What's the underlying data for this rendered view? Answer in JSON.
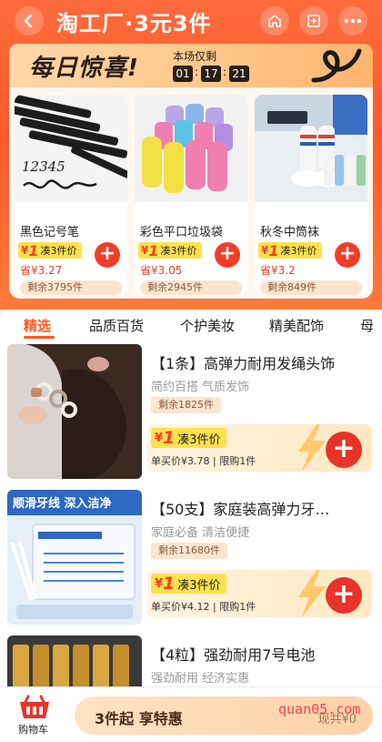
{
  "header": {
    "title": "淘工厂·3元3件",
    "back_icon": "back-arrow-icon",
    "home_icon": "home-icon",
    "fav_icon": "bookmark-icon",
    "more_icon": "more-dots-icon"
  },
  "banner": {
    "title": "每日惊喜!",
    "countdown_label": "本场仅剩",
    "countdown": [
      "01",
      "17",
      "21"
    ]
  },
  "deals": [
    {
      "name": "黑色记号笔",
      "price_yen": "¥",
      "price_num": "1",
      "price_suffix": "凑3件价",
      "save": "省¥3.27",
      "remain": "剩余3795件"
    },
    {
      "name": "彩色平口垃圾袋",
      "price_yen": "¥",
      "price_num": "1",
      "price_suffix": "凑3件价",
      "save": "省¥3.05",
      "remain": "剩余2945件"
    },
    {
      "name": "秋冬中筒袜",
      "price_yen": "¥",
      "price_num": "1",
      "price_suffix": "凑3件价",
      "save": "省¥3.2",
      "remain": "剩余849件"
    }
  ],
  "tabs": [
    "精选",
    "品质百货",
    "个护美妆",
    "精美配饰",
    "母"
  ],
  "items": [
    {
      "title": "【1条】高弹力耐用发绳头饰",
      "tags": "简约百搭 气质发饰",
      "remain": "剩余1825件",
      "price_yen": "¥",
      "price_num": "1",
      "price_suffix": "凑3件价",
      "info": "单买价¥3.78 | 限购1件"
    },
    {
      "title": "【50支】家庭装高弹力牙…",
      "tags": "家庭必备 清洁便捷",
      "remain": "剩余11680件",
      "price_yen": "¥",
      "price_num": "1",
      "price_suffix": "凑3件价",
      "info": "单买价¥4.12 | 限购1件"
    },
    {
      "title": "【4粒】强劲耐用7号电池",
      "tags": "强劲耐用 经济实惠",
      "remain": "",
      "price_yen": "",
      "price_num": "",
      "price_suffix": "",
      "info": ""
    }
  ],
  "bottom": {
    "cart_label": "购物车",
    "cta_text": "3件起 享特惠",
    "cash": "现共¥0"
  },
  "watermark": "quan05.com",
  "colors": {
    "accent": "#ff5a2a",
    "plus": "#f23c2a",
    "price_tag": "#ffe14d"
  }
}
